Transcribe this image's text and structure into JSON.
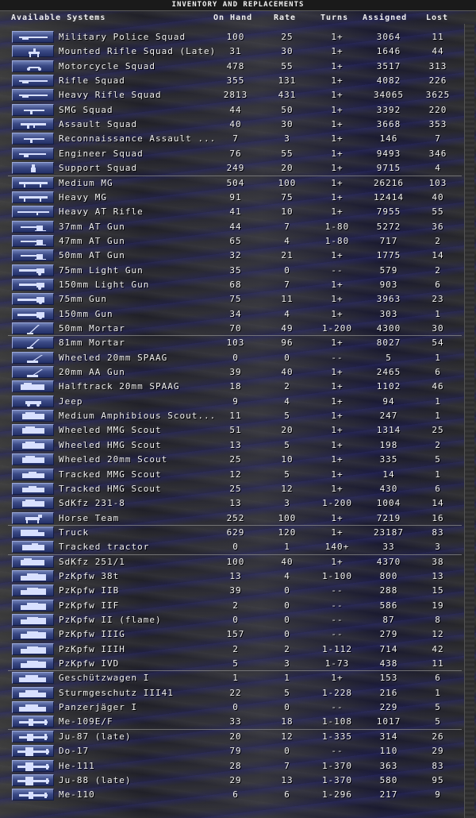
{
  "window": {
    "title": "INVENTORY AND REPLACEMENTS"
  },
  "columns": {
    "system": "Available Systems",
    "on_hand": "On Hand",
    "rate": "Rate",
    "turns": "Turns",
    "assigned": "Assigned",
    "lost": "Lost"
  },
  "colors": {
    "thumb_bg": "#3b4a86",
    "silhouette": "#d8e0ff",
    "text": "#f2f2f2"
  },
  "rows": [
    {
      "name": "Military Police Squad",
      "on_hand": "100",
      "rate": "25",
      "turns": "1+",
      "assigned": "3064",
      "lost": "11",
      "icon": "rifle-icon"
    },
    {
      "name": "Mounted Rifle Squad (Late)",
      "on_hand": "31",
      "rate": "30",
      "turns": "1+",
      "assigned": "1646",
      "lost": "44",
      "icon": "cavalry-icon"
    },
    {
      "name": "Motorcycle Squad",
      "on_hand": "478",
      "rate": "55",
      "turns": "1+",
      "assigned": "3517",
      "lost": "313",
      "icon": "motorcycle-icon"
    },
    {
      "name": "Rifle Squad",
      "on_hand": "355",
      "rate": "131",
      "turns": "1+",
      "assigned": "4082",
      "lost": "226",
      "icon": "rifle-icon"
    },
    {
      "name": "Heavy Rifle Squad",
      "on_hand": "2813",
      "rate": "431",
      "turns": "1+",
      "assigned": "34065",
      "lost": "3625",
      "icon": "rifle-icon"
    },
    {
      "name": "SMG Squad",
      "on_hand": "44",
      "rate": "50",
      "turns": "1+",
      "assigned": "3392",
      "lost": "220",
      "icon": "smg-icon"
    },
    {
      "name": "Assault Squad",
      "on_hand": "40",
      "rate": "30",
      "turns": "1+",
      "assigned": "3668",
      "lost": "353",
      "icon": "assault-rifle-icon"
    },
    {
      "name": "Reconnaissance Assault ...",
      "on_hand": "7",
      "rate": "3",
      "turns": "1+",
      "assigned": "146",
      "lost": "7",
      "icon": "smg-icon"
    },
    {
      "name": "Engineer Squad",
      "on_hand": "76",
      "rate": "55",
      "turns": "1+",
      "assigned": "9493",
      "lost": "346",
      "icon": "flamethrower-icon"
    },
    {
      "name": "Support Squad",
      "on_hand": "249",
      "rate": "20",
      "turns": "1+",
      "assigned": "9715",
      "lost": "4",
      "icon": "soldier-icon"
    },
    {
      "name": "Medium MG",
      "on_hand": "504",
      "rate": "100",
      "turns": "1+",
      "assigned": "26216",
      "lost": "103",
      "icon": "machine-gun-icon"
    },
    {
      "name": "Heavy MG",
      "on_hand": "91",
      "rate": "75",
      "turns": "1+",
      "assigned": "12414",
      "lost": "40",
      "icon": "machine-gun-icon"
    },
    {
      "name": "Heavy AT Rifle",
      "on_hand": "41",
      "rate": "10",
      "turns": "1+",
      "assigned": "7955",
      "lost": "55",
      "icon": "at-rifle-icon"
    },
    {
      "name": "37mm AT Gun",
      "on_hand": "44",
      "rate": "7",
      "turns": "1-80",
      "assigned": "5272",
      "lost": "36",
      "icon": "at-gun-icon"
    },
    {
      "name": "47mm AT Gun",
      "on_hand": "65",
      "rate": "4",
      "turns": "1-80",
      "assigned": "717",
      "lost": "2",
      "icon": "at-gun-icon"
    },
    {
      "name": "50mm AT Gun",
      "on_hand": "32",
      "rate": "21",
      "turns": "1+",
      "assigned": "1775",
      "lost": "14",
      "icon": "at-gun-icon"
    },
    {
      "name": "75mm Light Gun",
      "on_hand": "35",
      "rate": "0",
      "turns": "--",
      "assigned": "579",
      "lost": "2",
      "icon": "howitzer-icon"
    },
    {
      "name": "150mm Light Gun",
      "on_hand": "68",
      "rate": "7",
      "turns": "1+",
      "assigned": "903",
      "lost": "6",
      "icon": "howitzer-icon"
    },
    {
      "name": "75mm Gun",
      "on_hand": "75",
      "rate": "11",
      "turns": "1+",
      "assigned": "3963",
      "lost": "23",
      "icon": "field-gun-icon"
    },
    {
      "name": "150mm Gun",
      "on_hand": "34",
      "rate": "4",
      "turns": "1+",
      "assigned": "303",
      "lost": "1",
      "icon": "field-gun-icon"
    },
    {
      "name": "50mm Mortar",
      "on_hand": "70",
      "rate": "49",
      "turns": "1-200",
      "assigned": "4300",
      "lost": "30",
      "icon": "mortar-icon"
    },
    {
      "name": "81mm Mortar",
      "on_hand": "103",
      "rate": "96",
      "turns": "1+",
      "assigned": "8027",
      "lost": "54",
      "icon": "mortar-icon"
    },
    {
      "name": "Wheeled 20mm SPAAG",
      "on_hand": "0",
      "rate": "0",
      "turns": "--",
      "assigned": "5",
      "lost": "1",
      "icon": "aa-gun-icon"
    },
    {
      "name": "20mm AA Gun",
      "on_hand": "39",
      "rate": "40",
      "turns": "1+",
      "assigned": "2465",
      "lost": "6",
      "icon": "aa-gun-icon"
    },
    {
      "name": "Halftrack 20mm SPAAG",
      "on_hand": "18",
      "rate": "2",
      "turns": "1+",
      "assigned": "1102",
      "lost": "46",
      "icon": "halftrack-icon"
    },
    {
      "name": "Jeep",
      "on_hand": "9",
      "rate": "4",
      "turns": "1+",
      "assigned": "94",
      "lost": "1",
      "icon": "jeep-icon"
    },
    {
      "name": "Medium Amphibious Scout...",
      "on_hand": "11",
      "rate": "5",
      "turns": "1+",
      "assigned": "247",
      "lost": "1",
      "icon": "armored-car-icon"
    },
    {
      "name": "Wheeled MMG Scout",
      "on_hand": "51",
      "rate": "20",
      "turns": "1+",
      "assigned": "1314",
      "lost": "25",
      "icon": "armored-car-icon"
    },
    {
      "name": "Wheeled HMG Scout",
      "on_hand": "13",
      "rate": "5",
      "turns": "1+",
      "assigned": "198",
      "lost": "2",
      "icon": "armored-car-icon"
    },
    {
      "name": "Wheeled 20mm Scout",
      "on_hand": "25",
      "rate": "10",
      "turns": "1+",
      "assigned": "335",
      "lost": "5",
      "icon": "armored-car-icon"
    },
    {
      "name": "Tracked MMG Scout",
      "on_hand": "12",
      "rate": "5",
      "turns": "1+",
      "assigned": "14",
      "lost": "1",
      "icon": "tracked-scout-icon"
    },
    {
      "name": "Tracked HMG Scout",
      "on_hand": "25",
      "rate": "12",
      "turns": "1+",
      "assigned": "430",
      "lost": "6",
      "icon": "tracked-scout-icon"
    },
    {
      "name": "SdKfz 231-8",
      "on_hand": "13",
      "rate": "3",
      "turns": "1-200",
      "assigned": "1004",
      "lost": "14",
      "icon": "armored-car-icon"
    },
    {
      "name": "Horse Team",
      "on_hand": "252",
      "rate": "100",
      "turns": "1+",
      "assigned": "7219",
      "lost": "16",
      "icon": "horse-icon"
    },
    {
      "name": "Truck",
      "on_hand": "629",
      "rate": "120",
      "turns": "1+",
      "assigned": "23187",
      "lost": "83",
      "icon": "truck-icon"
    },
    {
      "name": "Tracked tractor",
      "on_hand": "0",
      "rate": "1",
      "turns": "140+",
      "assigned": "33",
      "lost": "3",
      "icon": "tractor-icon"
    },
    {
      "name": "SdKfz 251/1",
      "on_hand": "100",
      "rate": "40",
      "turns": "1+",
      "assigned": "4370",
      "lost": "38",
      "icon": "halftrack-icon"
    },
    {
      "name": "PzKpfw 38t",
      "on_hand": "13",
      "rate": "4",
      "turns": "1-100",
      "assigned": "800",
      "lost": "13",
      "icon": "tank-icon"
    },
    {
      "name": "PzKpfw IIB",
      "on_hand": "39",
      "rate": "0",
      "turns": "--",
      "assigned": "288",
      "lost": "15",
      "icon": "tank-icon"
    },
    {
      "name": "PzKpfw IIF",
      "on_hand": "2",
      "rate": "0",
      "turns": "--",
      "assigned": "586",
      "lost": "19",
      "icon": "tank-icon"
    },
    {
      "name": "PzKpfw II (flame)",
      "on_hand": "0",
      "rate": "0",
      "turns": "--",
      "assigned": "87",
      "lost": "8",
      "icon": "tank-icon"
    },
    {
      "name": "PzKpfw IIIG",
      "on_hand": "157",
      "rate": "0",
      "turns": "--",
      "assigned": "279",
      "lost": "12",
      "icon": "tank-icon"
    },
    {
      "name": "PzKpfw IIIH",
      "on_hand": "2",
      "rate": "2",
      "turns": "1-112",
      "assigned": "714",
      "lost": "42",
      "icon": "tank-icon"
    },
    {
      "name": "PzKpfw IVD",
      "on_hand": "5",
      "rate": "3",
      "turns": "1-73",
      "assigned": "438",
      "lost": "11",
      "icon": "tank-icon"
    },
    {
      "name": "Geschützwagen I",
      "on_hand": "1",
      "rate": "1",
      "turns": "1+",
      "assigned": "153",
      "lost": "6",
      "icon": "spg-icon"
    },
    {
      "name": "Sturmgeschutz III41",
      "on_hand": "22",
      "rate": "5",
      "turns": "1-228",
      "assigned": "216",
      "lost": "1",
      "icon": "spg-icon"
    },
    {
      "name": "Panzerjäger I",
      "on_hand": "0",
      "rate": "0",
      "turns": "--",
      "assigned": "229",
      "lost": "5",
      "icon": "spg-icon"
    },
    {
      "name": "Me-109E/F",
      "on_hand": "33",
      "rate": "18",
      "turns": "1-108",
      "assigned": "1017",
      "lost": "5",
      "icon": "fighter-plane-icon"
    },
    {
      "name": "Ju-87 (late)",
      "on_hand": "20",
      "rate": "12",
      "turns": "1-335",
      "assigned": "314",
      "lost": "26",
      "icon": "dive-bomber-icon"
    },
    {
      "name": "Do-17",
      "on_hand": "79",
      "rate": "0",
      "turns": "--",
      "assigned": "110",
      "lost": "29",
      "icon": "bomber-plane-icon"
    },
    {
      "name": "He-111",
      "on_hand": "28",
      "rate": "7",
      "turns": "1-370",
      "assigned": "363",
      "lost": "83",
      "icon": "bomber-plane-icon"
    },
    {
      "name": "Ju-88 (late)",
      "on_hand": "29",
      "rate": "13",
      "turns": "1-370",
      "assigned": "580",
      "lost": "95",
      "icon": "bomber-plane-icon"
    },
    {
      "name": "Me-110",
      "on_hand": "6",
      "rate": "6",
      "turns": "1-296",
      "assigned": "217",
      "lost": "9",
      "icon": "fighter-plane-icon"
    }
  ]
}
